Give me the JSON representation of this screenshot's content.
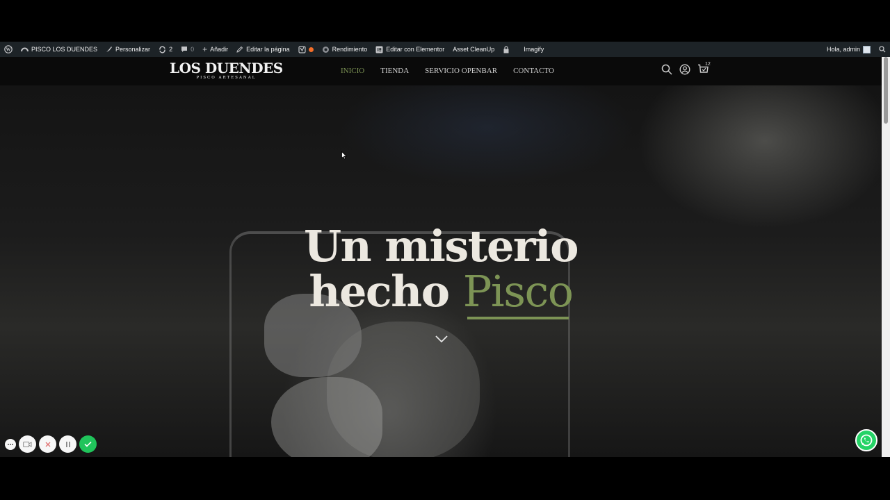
{
  "adminbar": {
    "site_name": "PISCO LOS DUENDES",
    "customize": "Personalizar",
    "updates_count": "2",
    "comments_count": "0",
    "add_new": "Añadir",
    "edit_page": "Editar la página",
    "performance": "Rendimiento",
    "edit_elementor": "Editar con Elementor",
    "asset_cleanup": "Asset CleanUp",
    "imagify": "Imagify",
    "greeting": "Hola, admin"
  },
  "header": {
    "logo_name": "LOS DUENDES",
    "logo_sub": "PISCO ARTESANAL",
    "menu": [
      {
        "label": "INICIO",
        "active": true
      },
      {
        "label": "TIENDA",
        "active": false
      },
      {
        "label": "SERVICIO OPENBAR",
        "active": false
      },
      {
        "label": "CONTACTO",
        "active": false
      }
    ],
    "cart_count": "12"
  },
  "hero": {
    "line1": "Un misterio",
    "line2_plain": "hecho",
    "line2_accent": "Pisco"
  },
  "colors": {
    "accent": "#7d9455",
    "adminbar": "#1d2327",
    "whatsapp": "#25d366",
    "record_confirm": "#20c45b"
  }
}
